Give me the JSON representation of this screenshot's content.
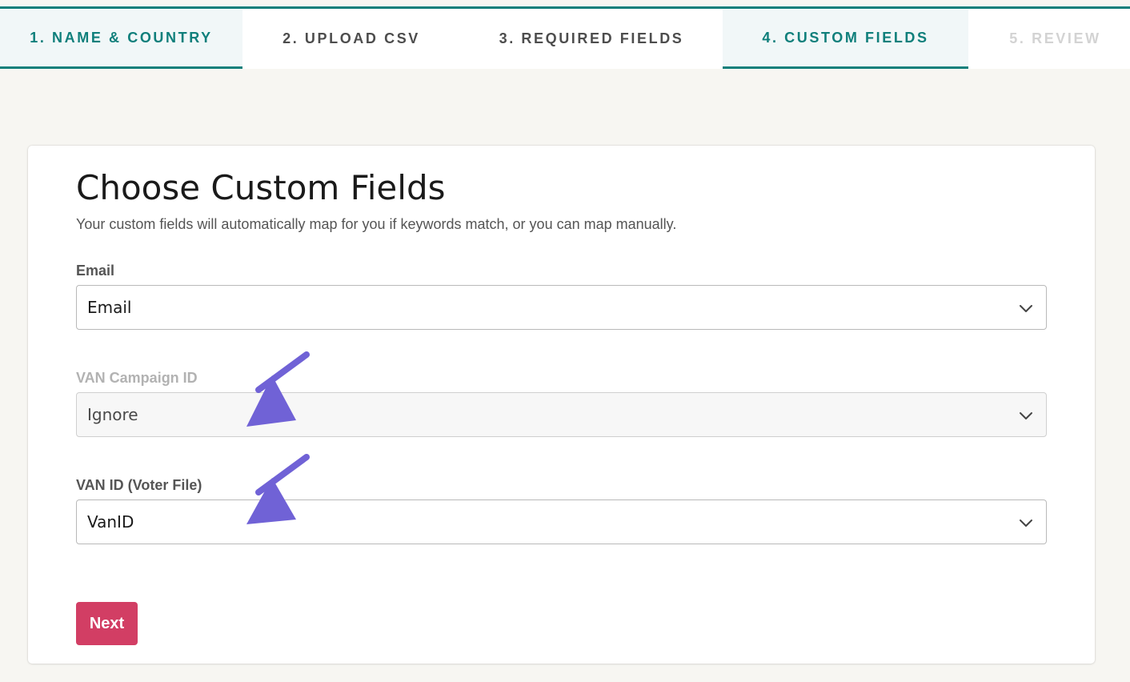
{
  "stepper": {
    "steps": [
      {
        "label": "1. NAME & COUNTRY",
        "state": "completed"
      },
      {
        "label": "2. UPLOAD CSV",
        "state": "default"
      },
      {
        "label": "3. REQUIRED FIELDS",
        "state": "default"
      },
      {
        "label": "4. CUSTOM FIELDS",
        "state": "active"
      },
      {
        "label": "5. REVIEW",
        "state": "disabled"
      }
    ]
  },
  "form": {
    "title": "Choose Custom Fields",
    "subtitle": "Your custom fields will automatically map for you if keywords match, or you can map manually.",
    "fields": [
      {
        "label": "Email",
        "value": "Email",
        "enabled": true
      },
      {
        "label": "VAN Campaign ID",
        "value": "Ignore",
        "enabled": false
      },
      {
        "label": "VAN ID (Voter File)",
        "value": "VanID",
        "enabled": true
      }
    ],
    "next_label": "Next"
  },
  "icons": {
    "select_indicator": "chevron-down-icon",
    "annotation": "arrow-icon"
  },
  "colors": {
    "accent_teal": "#0f7f7b",
    "next_button": "#d23e64",
    "annotation_arrow": "#7062d6",
    "page_background": "#f7f6f2"
  }
}
